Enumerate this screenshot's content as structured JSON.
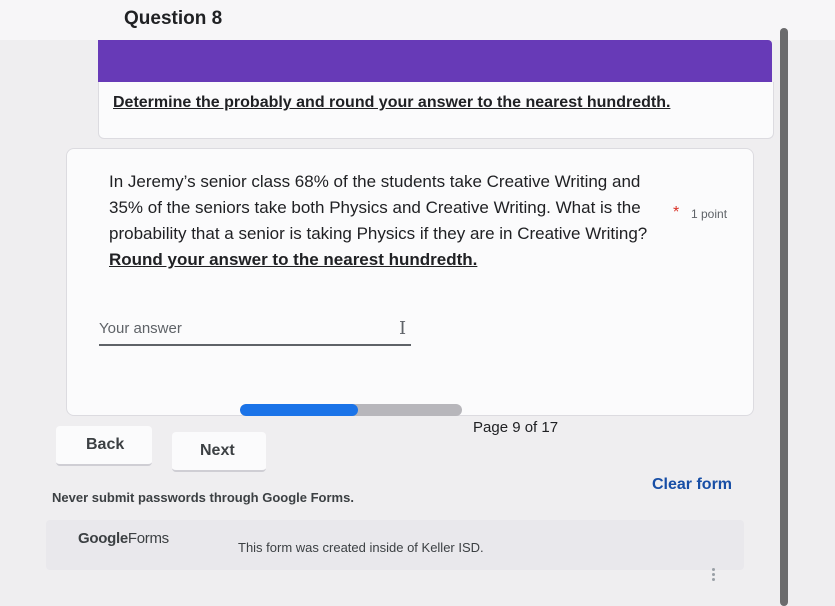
{
  "section": {
    "title": "Question 8",
    "description": "Determine the probably and round your answer to the nearest hundredth."
  },
  "question": {
    "text": "In Jeremy’s senior class 68% of the students take Creative Writing and 35% of the seniors take both Physics and Creative Writing. What is the probability that a senior is taking Physics if they are in Creative Writing?",
    "emphasis": "Round your answer to the nearest hundredth.",
    "required_marker": "*",
    "points": "1 point",
    "answer": {
      "placeholder": "Your answer",
      "value": ""
    }
  },
  "progress": {
    "page_label": "Page 9 of 17",
    "fraction": 0.53
  },
  "navigation": {
    "back_label": "Back",
    "next_label": "Next",
    "clear_label": "Clear form"
  },
  "footer": {
    "warning": "Never submit passwords through Google Forms.",
    "logo_google": "Google",
    "logo_forms": "Forms",
    "created_note": "This form was created inside of Keller ISD."
  },
  "colors": {
    "theme_purple": "#673ab7",
    "progress_blue": "#1a73e8",
    "required_red": "#d93025",
    "link_blue": "#174ea6"
  }
}
